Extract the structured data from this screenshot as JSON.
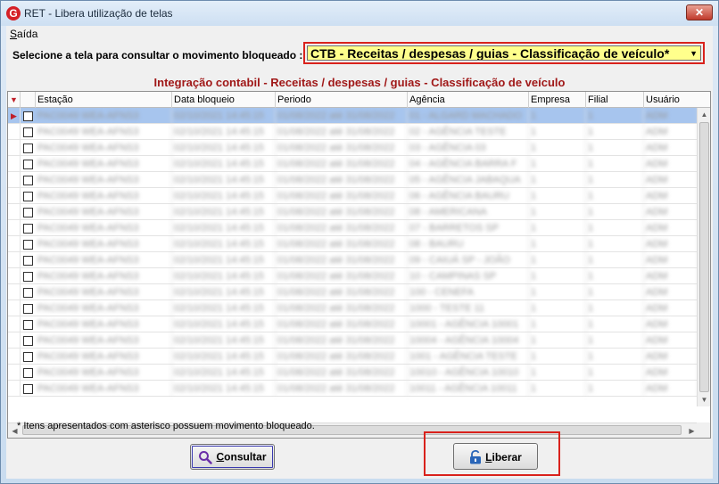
{
  "window": {
    "title": "RET - Libera utilização de telas",
    "close_label": "✕",
    "app_icon_glyph": "G"
  },
  "menu": {
    "items": [
      {
        "first": "S",
        "rest": "aída"
      }
    ]
  },
  "selector": {
    "label": "Selecione a tela para consultar o movimento bloqueado :",
    "value": "CTB - Receitas / despesas / guias - Classificação de veículo*",
    "highlight_color": "#ffff8c",
    "frame_color": "#d9221c"
  },
  "grid": {
    "title": "Integração contabil - Receitas / despesas / guias - Classificação de veículo",
    "columns": [
      "Estação",
      "Data bloqueio",
      "Periodo",
      "Agência",
      "Empresa",
      "Filial",
      "Usuário"
    ],
    "rows": [
      [
        "PAC0049 WEA-AFNS3",
        "02/10/2021 14:45:15",
        "01/08/2022 até 31/08/2022",
        "01 - ALGARD MACHADO",
        "1",
        "1",
        "ADM"
      ],
      [
        "PAC0049 WEA-AFNS3",
        "02/10/2021 14:45:15",
        "01/08/2022 até 31/08/2022",
        "02 - AGÊNCIA TESTE",
        "1",
        "1",
        "ADM"
      ],
      [
        "PAC0049 WEA-AFNS3",
        "02/10/2021 14:45:15",
        "01/08/2022 até 31/08/2022",
        "03 - AGÊNCIA 03",
        "1",
        "1",
        "ADM"
      ],
      [
        "PAC0049 WEA-AFNS3",
        "02/10/2021 14:45:15",
        "01/08/2022 até 31/08/2022",
        "04 - AGÊNCIA BARRA F",
        "1",
        "1",
        "ADM"
      ],
      [
        "PAC0049 WEA-AFNS3",
        "02/10/2021 14:45:15",
        "01/08/2022 até 31/08/2022",
        "05 - AGÊNCIA JABAQUA",
        "1",
        "1",
        "ADM"
      ],
      [
        "PAC0049 WEA-AFNS3",
        "02/10/2021 14:45:15",
        "01/08/2022 até 31/08/2022",
        "06 - AGÊNCIA BAURU",
        "1",
        "1",
        "ADM"
      ],
      [
        "PAC0049 WEA-AFNS3",
        "02/10/2021 14:45:15",
        "01/08/2022 até 31/08/2022",
        "08 - AMERICANA",
        "1",
        "1",
        "ADM"
      ],
      [
        "PAC0049 WEA-AFNS3",
        "02/10/2021 14:45:15",
        "01/08/2022 até 31/08/2022",
        "07 - BARRETOS SP",
        "1",
        "1",
        "ADM"
      ],
      [
        "PAC0049 WEA-AFNS3",
        "02/10/2021 14:45:15",
        "01/08/2022 até 31/08/2022",
        "08 - BAURU",
        "1",
        "1",
        "ADM"
      ],
      [
        "PAC0049 WEA-AFNS3",
        "02/10/2021 14:45:15",
        "01/08/2022 até 31/08/2022",
        "09 - CAIUÁ SP - JOÃO",
        "1",
        "1",
        "ADM"
      ],
      [
        "PAC0049 WEA-AFNS3",
        "02/10/2021 14:45:15",
        "01/08/2022 até 31/08/2022",
        "10 - CAMPINAS SP",
        "1",
        "1",
        "ADM"
      ],
      [
        "PAC0049 WEA-AFNS3",
        "02/10/2021 14:45:15",
        "01/08/2022 até 31/08/2022",
        "100 - CENEFA",
        "1",
        "1",
        "ADM"
      ],
      [
        "PAC0049 WEA-AFNS3",
        "02/10/2021 14:45:15",
        "01/08/2022 até 31/08/2022",
        "1000 - TESTE 11",
        "1",
        "1",
        "ADM"
      ],
      [
        "PAC0049 WEA-AFNS3",
        "02/10/2021 14:45:15",
        "01/08/2022 até 31/08/2022",
        "10001 - AGÊNCIA 10001",
        "1",
        "1",
        "ADM"
      ],
      [
        "PAC0049 WEA-AFNS3",
        "02/10/2021 14:45:15",
        "01/08/2022 até 31/08/2022",
        "10004 - AGÊNCIA 10004",
        "1",
        "1",
        "ADM"
      ],
      [
        "PAC0049 WEA-AFNS3",
        "02/10/2021 14:45:15",
        "01/08/2022 até 31/08/2022",
        "1001 - AGÊNCIA TESTE",
        "1",
        "1",
        "ADM"
      ],
      [
        "PAC0049 WEA-AFNS3",
        "02/10/2021 14:45:15",
        "01/08/2022 até 31/08/2022",
        "10010 - AGÊNCIA 10010",
        "1",
        "1",
        "ADM"
      ],
      [
        "PAC0049 WEA-AFNS3",
        "02/10/2021 14:45:15",
        "01/08/2022 até 31/08/2022",
        "10011 - AGÊNCIA 10011",
        "1",
        "1",
        "ADM"
      ]
    ]
  },
  "footnote": "* Itens apresentados com asterisco possuem movimento bloqueado.",
  "buttons": {
    "consultar": {
      "first": "C",
      "rest": "onsultar"
    },
    "liberar": {
      "first": "L",
      "rest": "iberar"
    }
  },
  "colors": {
    "selected_row": "#a7c5ee",
    "title_red": "#a01818"
  }
}
